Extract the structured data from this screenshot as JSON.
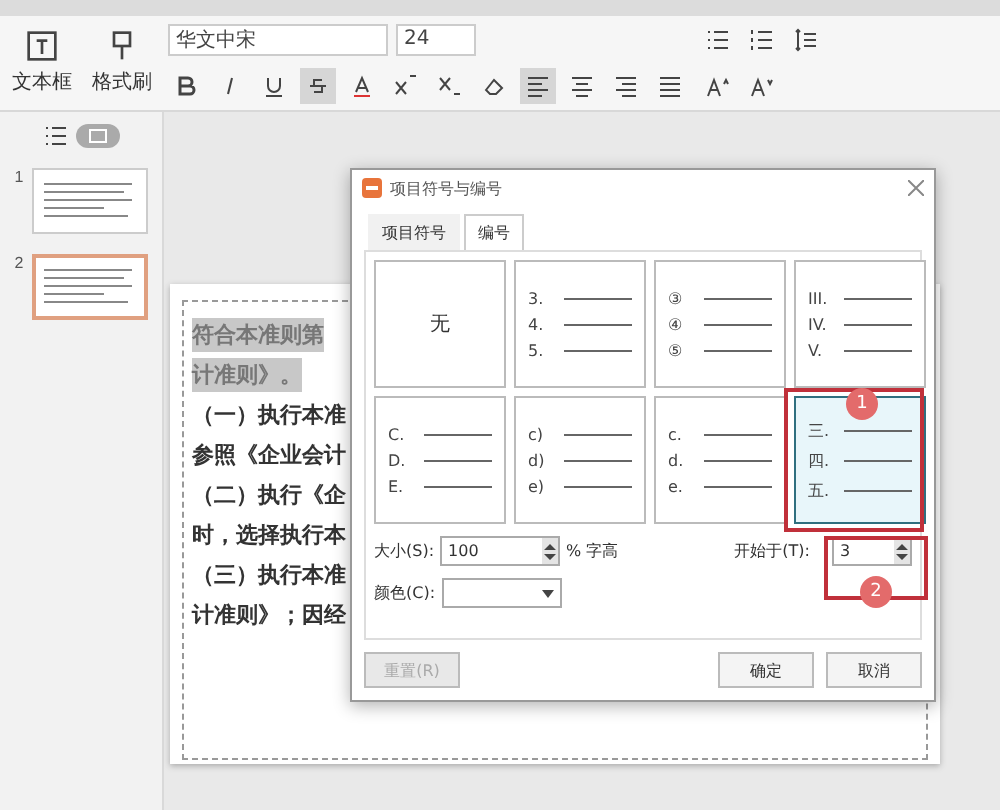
{
  "toolbar": {
    "textbox_label": "文本框",
    "format_painter_label": "格式刷",
    "font": "华文中宋",
    "size": "24"
  },
  "slides_panel": {
    "slides": [
      {
        "number": "1",
        "selected": false
      },
      {
        "number": "2",
        "selected": true
      }
    ]
  },
  "slide": {
    "lines": [
      {
        "text": "符合本准则第",
        "highlighted": true
      },
      {
        "text": "计准则》。",
        "highlighted": true
      },
      {
        "text": "（一）执行本准",
        "highlighted": false
      },
      {
        "text": "参照《企业会计",
        "highlighted": false
      },
      {
        "text": "（二）执行《企",
        "highlighted": false
      },
      {
        "text": "时，选择执行本",
        "highlighted": false
      },
      {
        "text": "（三）执行本准",
        "highlighted": false
      },
      {
        "text": "计准则》；因经",
        "highlighted": false
      }
    ]
  },
  "dialog": {
    "title": "项目符号与编号",
    "tabs": [
      {
        "label": "项目符号",
        "selected": false
      },
      {
        "label": "编号",
        "selected": true
      }
    ],
    "styles": [
      {
        "kind": "none",
        "label": "无",
        "selected": false
      },
      {
        "kind": "list",
        "markers": [
          "3.",
          "4.",
          "5."
        ],
        "selected": false
      },
      {
        "kind": "list",
        "markers": [
          "③",
          "④",
          "⑤"
        ],
        "selected": false
      },
      {
        "kind": "list",
        "markers": [
          "III.",
          "IV.",
          "V."
        ],
        "selected": false
      },
      {
        "kind": "list",
        "markers": [
          "C.",
          "D.",
          "E."
        ],
        "selected": false
      },
      {
        "kind": "list",
        "markers": [
          "c)",
          "d)",
          "e)"
        ],
        "selected": false
      },
      {
        "kind": "list",
        "markers": [
          "c.",
          "d.",
          "e."
        ],
        "selected": false
      },
      {
        "kind": "list",
        "markers": [
          "三.",
          "四.",
          "五."
        ],
        "selected": true
      }
    ],
    "size_label": "大小(S):",
    "size_value": "100",
    "size_unit": "% 字高",
    "start_label": "开始于(T):",
    "start_value": "3",
    "color_label": "颜色(C):",
    "buttons": [
      {
        "label": "重置(R)",
        "disabled": true
      },
      {
        "label": "确定",
        "disabled": false
      },
      {
        "label": "取消",
        "disabled": false
      }
    ]
  },
  "annotations": [
    {
      "number": "1"
    },
    {
      "number": "2"
    }
  ]
}
